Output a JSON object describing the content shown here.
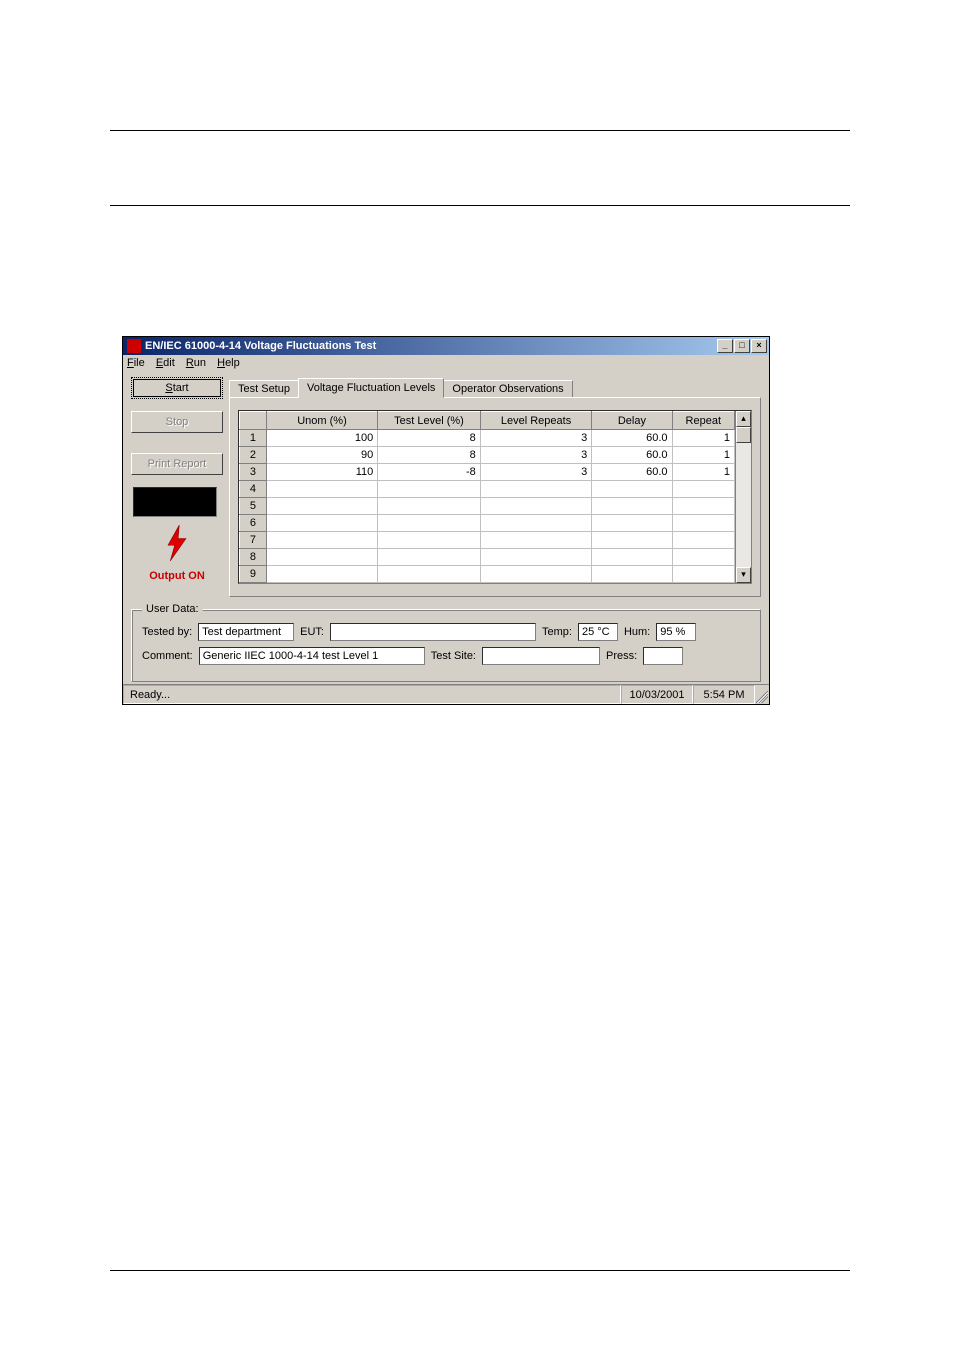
{
  "window": {
    "title": "EN/IEC 61000-4-14 Voltage Fluctuations Test"
  },
  "menu": {
    "file": "File",
    "edit": "Edit",
    "run": "Run",
    "help": "Help"
  },
  "buttons": {
    "start": "Start",
    "stop": "Stop",
    "print": "Print Report"
  },
  "output": {
    "label": "Output ON"
  },
  "tabs": {
    "setup": "Test Setup",
    "levels": "Voltage Fluctuation Levels",
    "obs": "Operator Observations"
  },
  "grid": {
    "headers": {
      "unom": "Unom (%)",
      "level": "Test Level (%)",
      "reps": "Level Repeats",
      "delay": "Delay",
      "repeat": "Repeat"
    },
    "rows": [
      {
        "n": "1",
        "unom": "100",
        "level": "8",
        "reps": "3",
        "delay": "60.0",
        "repeat": "1"
      },
      {
        "n": "2",
        "unom": "90",
        "level": "8",
        "reps": "3",
        "delay": "60.0",
        "repeat": "1"
      },
      {
        "n": "3",
        "unom": "110",
        "level": "-8",
        "reps": "3",
        "delay": "60.0",
        "repeat": "1"
      },
      {
        "n": "4"
      },
      {
        "n": "5"
      },
      {
        "n": "6"
      },
      {
        "n": "7"
      },
      {
        "n": "8"
      },
      {
        "n": "9"
      }
    ]
  },
  "userdata": {
    "legend": "User Data:",
    "tested_by_label": "Tested by:",
    "tested_by": "Test department",
    "eut_label": "EUT:",
    "eut": "",
    "temp_label": "Temp:",
    "temp": "25 °C",
    "hum_label": "Hum:",
    "hum": "95 %",
    "comment_label": "Comment:",
    "comment": "Generic IIEC 1000-4-14 test Level 1",
    "site_label": "Test Site:",
    "site": "",
    "press_label": "Press:",
    "press": ""
  },
  "status": {
    "ready": "Ready...",
    "date": "10/03/2001",
    "time": "5:54 PM"
  }
}
